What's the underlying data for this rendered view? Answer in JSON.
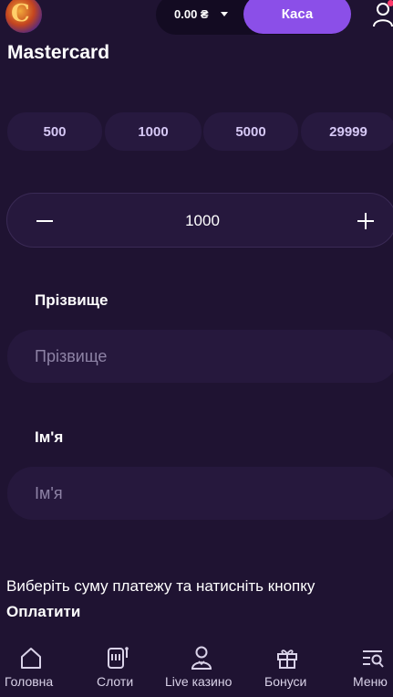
{
  "header": {
    "balance": "0.00 ₴",
    "cashier_label": "Каса"
  },
  "page": {
    "title": "Mastercard"
  },
  "amount_presets": [
    "500",
    "1000",
    "5000",
    "29999"
  ],
  "stepper": {
    "value": "1000"
  },
  "fields": {
    "surname": {
      "label": "Прізвище",
      "placeholder": "Прізвище"
    },
    "first_name": {
      "label": "Ім'я",
      "placeholder": "Ім'я"
    }
  },
  "instructions": {
    "text": "Виберіть суму платежу та натисніть кнопку ",
    "emphasis": "Оплатити"
  },
  "bottom_nav": [
    {
      "label": "Головна",
      "icon": "home-icon"
    },
    {
      "label": "Слоти",
      "icon": "slot-machine-icon"
    },
    {
      "label": "Live казино",
      "icon": "dealer-icon"
    },
    {
      "label": "Бонуси",
      "icon": "gift-icon"
    },
    {
      "label": "Меню",
      "icon": "menu-search-icon"
    }
  ],
  "colors": {
    "background": "#1f1332",
    "accent": "#8b4fe8",
    "surface": "#26183d",
    "chip_text": "#d6c8f5"
  }
}
